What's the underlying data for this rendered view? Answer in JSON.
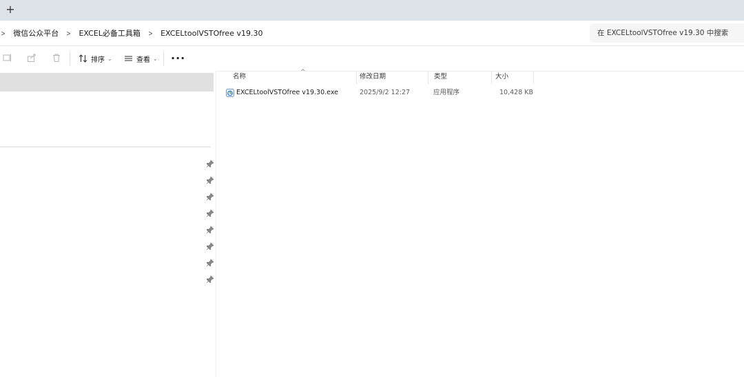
{
  "tabbar": {
    "new_tab_glyph": "+"
  },
  "breadcrumb": {
    "items": [
      "微信公众平台",
      "EXCEL必备工具箱",
      "EXCELtoolVSTOfree v19.30"
    ]
  },
  "search": {
    "placeholder": "在 EXCELtoolVSTOfree v19.30 中搜索"
  },
  "commandbar": {
    "sort_label": "排序",
    "view_label": "查看",
    "more_label": "···"
  },
  "columns": {
    "name": "名称",
    "modified": "修改日期",
    "type": "类型",
    "size": "大小"
  },
  "files": [
    {
      "name": "EXCELtoolVSTOfree v19.30.exe",
      "modified": "2025/9/2 12:27",
      "type": "应用程序",
      "size": "10,428 KB",
      "icon": "exe-icon"
    }
  ],
  "nav": {
    "pinned_count": 8
  },
  "colors": {
    "tabbar_bg": "#dde1e8",
    "nav_selected_bg": "#e0e0e0"
  }
}
